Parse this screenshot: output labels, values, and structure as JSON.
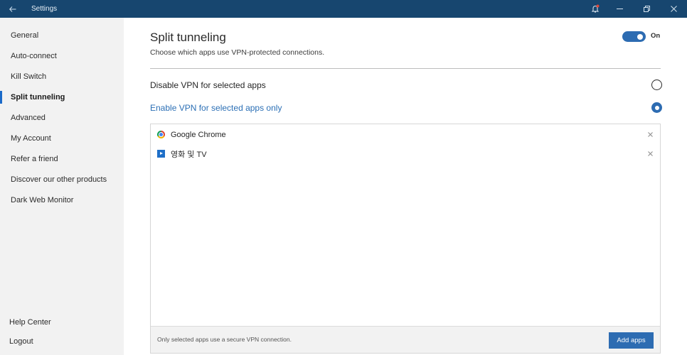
{
  "titlebar": {
    "title": "Settings",
    "back_icon": "arrow-left",
    "bell_icon": "bell-with-notification-dot",
    "minimize_icon": "minimize",
    "restore_icon": "restore",
    "close_icon": "close",
    "bg_color": "#17466f",
    "badge_color": "#e0473a"
  },
  "sidebar": {
    "items": [
      {
        "label": "General"
      },
      {
        "label": "Auto-connect"
      },
      {
        "label": "Kill Switch"
      },
      {
        "label": "Split tunneling",
        "active": true
      },
      {
        "label": "Advanced"
      },
      {
        "label": "My Account"
      },
      {
        "label": "Refer a friend"
      },
      {
        "label": "Discover our other products"
      },
      {
        "label": "Dark Web Monitor"
      }
    ],
    "bottom": [
      {
        "label": "Help Center"
      },
      {
        "label": "Logout"
      }
    ],
    "accent": "#1b6ac9"
  },
  "main": {
    "title": "Split tunneling",
    "subtitle": "Choose which apps use VPN-protected connections.",
    "toggle": {
      "label": "On",
      "on": true
    },
    "options": [
      {
        "label": "Disable VPN for selected apps",
        "selected": false
      },
      {
        "label": "Enable VPN for selected apps only",
        "selected": true
      }
    ],
    "apps": [
      {
        "name": "Google Chrome",
        "icon": "chrome-icon"
      },
      {
        "name": "영화 및 TV",
        "icon": "movies-tv-icon"
      }
    ],
    "footer_text": "Only selected apps use a secure VPN connection.",
    "add_button": "Add apps",
    "accent": "#2d6cb2"
  }
}
